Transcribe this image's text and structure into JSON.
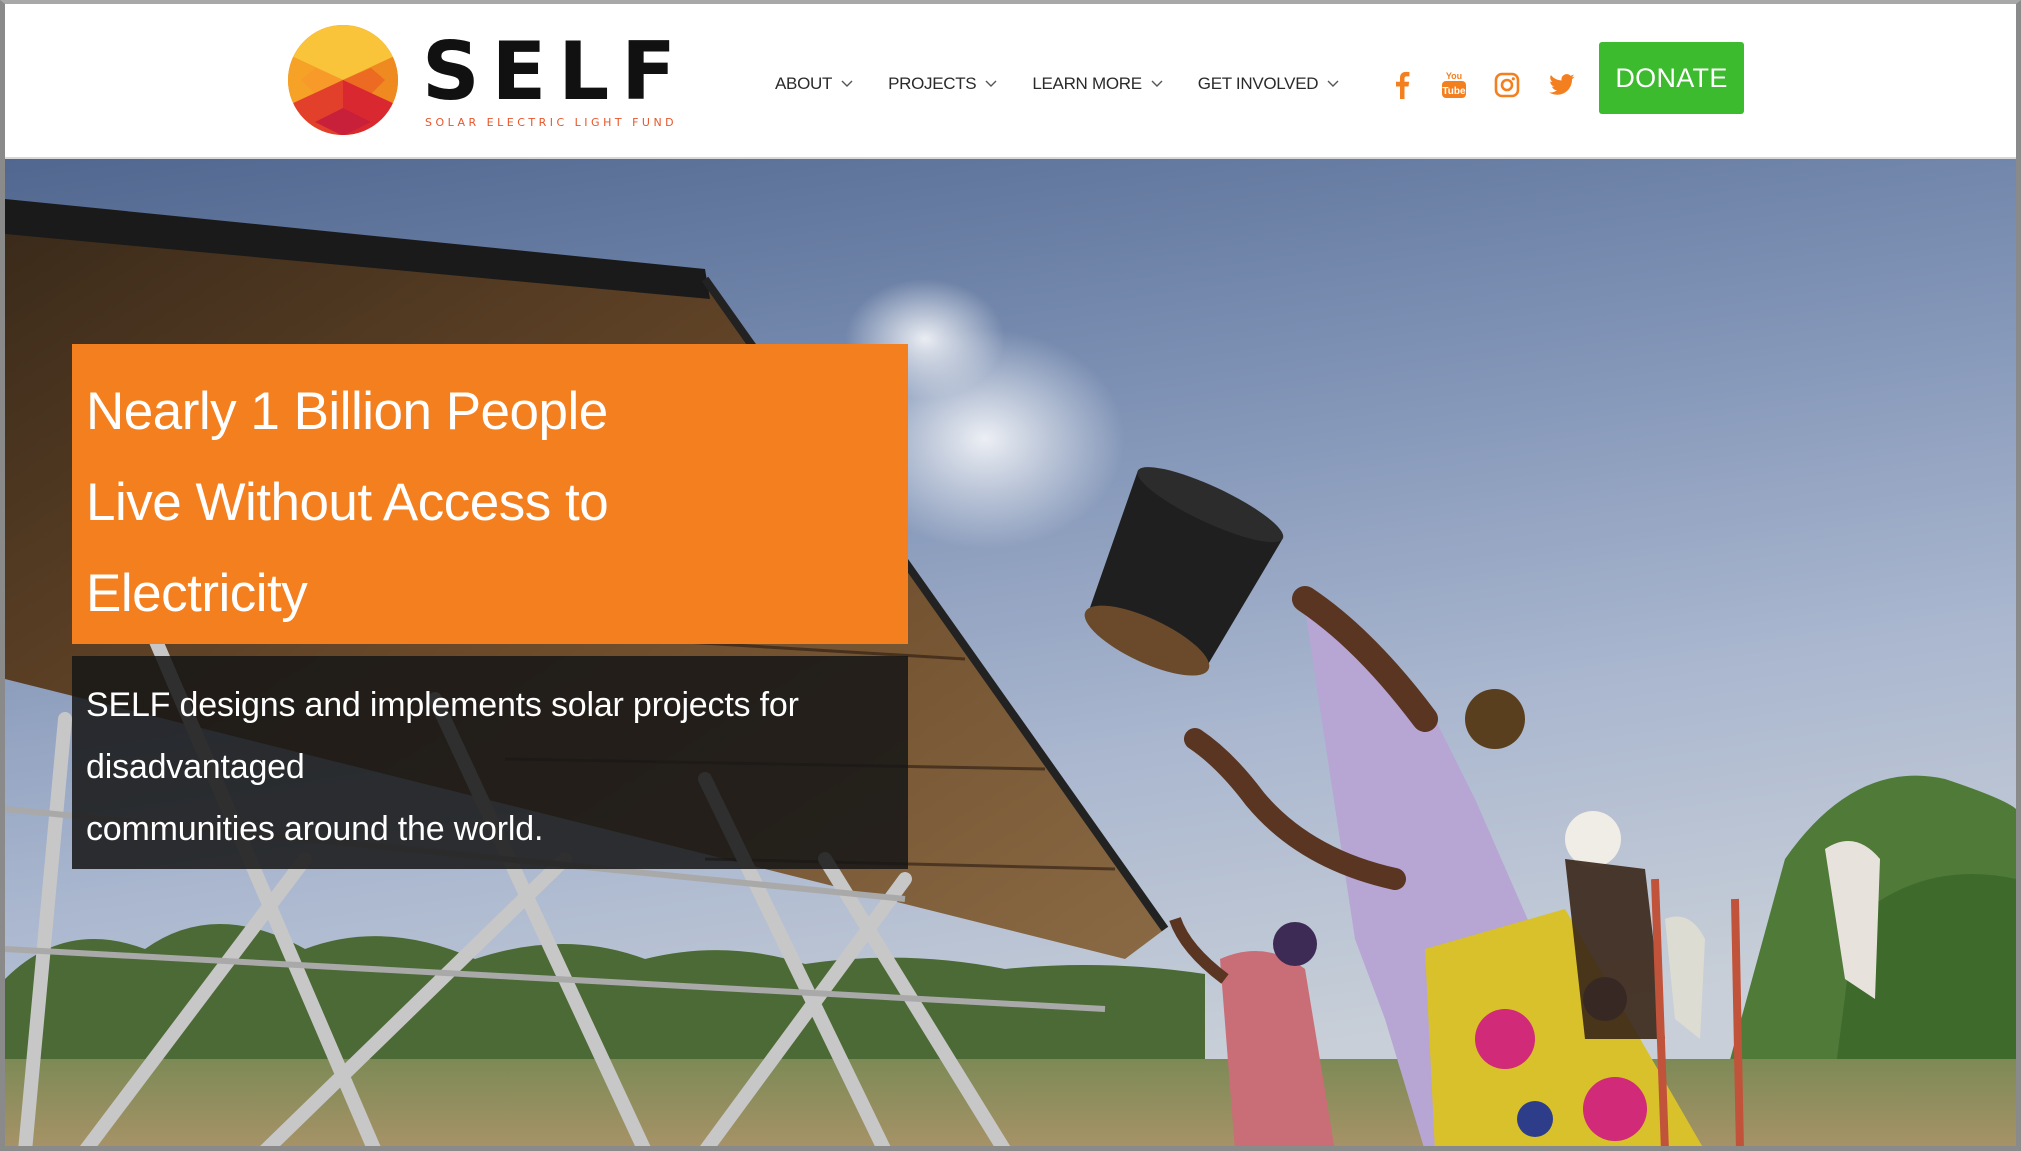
{
  "brand": {
    "name": "SELF",
    "tagline": "SOLAR ELECTRIC LIGHT FUND",
    "logo_colors": [
      "#f7b531",
      "#f47f1f",
      "#e8552a",
      "#d9282f"
    ]
  },
  "nav": {
    "items": [
      {
        "label": "ABOUT"
      },
      {
        "label": "PROJECTS"
      },
      {
        "label": "LEARN MORE"
      },
      {
        "label": "GET INVOLVED"
      }
    ],
    "dropdown_icon": "chevron-down-icon"
  },
  "social": {
    "color": "#f47f1f",
    "icons": [
      "facebook-icon",
      "youtube-icon",
      "instagram-icon",
      "twitter-icon"
    ],
    "youtube_text": "You Tube"
  },
  "donate": {
    "label": "DONATE",
    "color": "#3cbb2e"
  },
  "hero": {
    "headline_lines": [
      "Nearly 1 Billion People",
      "Live Without Access to",
      "Electricity"
    ],
    "subtext_lines": [
      "SELF designs and implements solar projects for",
      "disadvantaged",
      "communities around the world."
    ],
    "headline_bg": "#f47f1f",
    "subtext_bg": "#161616"
  }
}
